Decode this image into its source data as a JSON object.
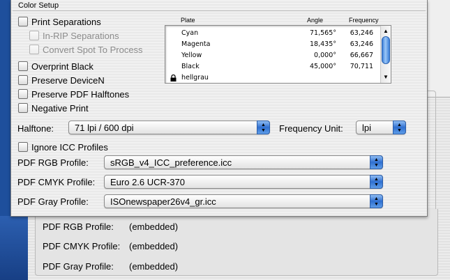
{
  "background": {
    "embedded_rows": [
      {
        "label": "PDF RGB Profile:",
        "value": "(embedded)"
      },
      {
        "label": "PDF CMYK Profile:",
        "value": "(embedded)"
      },
      {
        "label": "PDF Gray Profile:",
        "value": "(embedded)"
      }
    ]
  },
  "dialog": {
    "title": "Color Setup",
    "checkboxes": {
      "print_separations": {
        "label": "Print Separations",
        "checked": false
      },
      "in_rip_separations": {
        "label": "In-RIP Separations",
        "checked": false,
        "disabled": true
      },
      "convert_spot": {
        "label": "Convert Spot To Process",
        "checked": false,
        "disabled": true
      },
      "overprint_black": {
        "label": "Overprint Black",
        "checked": false
      },
      "preserve_devicen": {
        "label": "Preserve DeviceN",
        "checked": false
      },
      "preserve_pdf_halftones": {
        "label": "Preserve PDF Halftones",
        "checked": false
      },
      "negative_print": {
        "label": "Negative Print",
        "checked": false
      },
      "ignore_icc": {
        "label": "Ignore ICC Profiles",
        "checked": false
      }
    },
    "plates": {
      "headers": {
        "plate": "Plate",
        "angle": "Angle",
        "frequency": "Frequency"
      },
      "rows": [
        {
          "name": "Cyan",
          "angle": "71,565°",
          "frequency": "63,246",
          "locked": false
        },
        {
          "name": "Magenta",
          "angle": "18,435°",
          "frequency": "63,246",
          "locked": false
        },
        {
          "name": "Yellow",
          "angle": "0,000°",
          "frequency": "66,667",
          "locked": false
        },
        {
          "name": "Black",
          "angle": "45,000°",
          "frequency": "70,711",
          "locked": false
        },
        {
          "name": "hellgrau",
          "angle": "",
          "frequency": "",
          "locked": true
        }
      ]
    },
    "halftone": {
      "label": "Halftone:",
      "value": "71 lpi / 600 dpi"
    },
    "frequency_unit": {
      "label": "Frequency Unit:",
      "value": "lpi"
    },
    "profiles": {
      "rgb": {
        "label": "PDF RGB Profile:",
        "value": "sRGB_v4_ICC_preference.icc"
      },
      "cmyk": {
        "label": "PDF CMYK Profile:",
        "value": "Euro 2.6 UCR-370"
      },
      "gray": {
        "label": "PDF Gray Profile:",
        "value": "ISOnewspaper26v4_gr.icc"
      }
    }
  },
  "colors": {
    "desktop_blue": "#1e4f9c",
    "aqua_blue": "#2f6fd0"
  }
}
